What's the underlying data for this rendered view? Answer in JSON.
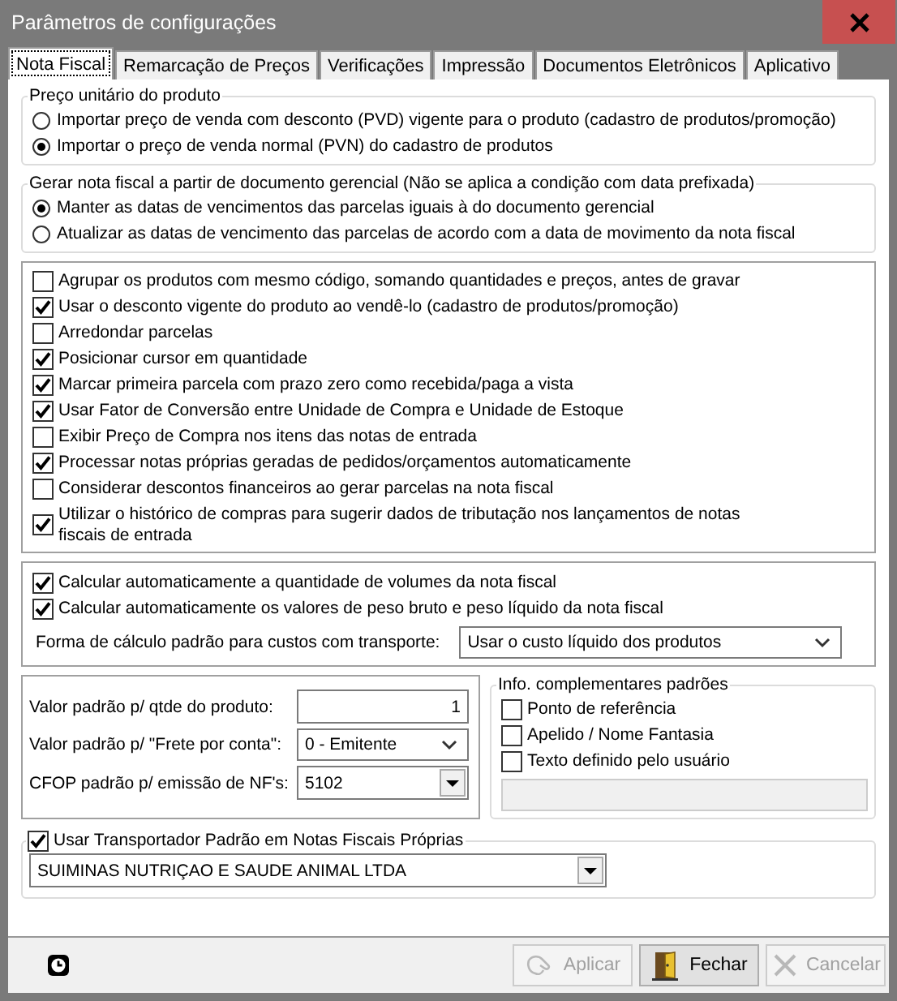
{
  "window": {
    "title": "Parâmetros de configurações"
  },
  "tabs": [
    {
      "label": "Nota Fiscal",
      "selected": true
    },
    {
      "label": "Remarcação de Preços",
      "selected": false
    },
    {
      "label": "Verificações",
      "selected": false
    },
    {
      "label": "Impressão",
      "selected": false
    },
    {
      "label": "Documentos Eletrônicos",
      "selected": false
    },
    {
      "label": "Aplicativo",
      "selected": false
    }
  ],
  "price_group": {
    "title": "Preço unitário do produto",
    "options": [
      {
        "label": "Importar preço de venda com desconto (PVD) vigente para o produto (cadastro de produtos/promoção)",
        "selected": false
      },
      {
        "label": "Importar o preço de venda normal (PVN) do cadastro de produtos",
        "selected": true
      }
    ]
  },
  "document_group": {
    "title": "Gerar nota fiscal a partir de documento gerencial (Não se aplica a condição com data prefixada)",
    "options": [
      {
        "label": "Manter as datas de vencimentos das parcelas iguais à do documento gerencial",
        "selected": true
      },
      {
        "label": "Atualizar as datas de vencimento das parcelas de acordo com a data de movimento da nota fiscal",
        "selected": false
      }
    ]
  },
  "options": [
    {
      "label": "Agrupar os produtos com mesmo código, somando quantidades e preços, antes de gravar",
      "checked": false
    },
    {
      "label": "Usar o desconto vigente do produto ao vendê-lo (cadastro de produtos/promoção)",
      "checked": true
    },
    {
      "label": "Arredondar parcelas",
      "checked": false
    },
    {
      "label": "Posicionar cursor em quantidade",
      "checked": true
    },
    {
      "label": "Marcar primeira parcela com prazo zero como recebida/paga a vista",
      "checked": true
    },
    {
      "label": "Usar Fator de Conversão entre Unidade de Compra e Unidade de Estoque",
      "checked": true
    },
    {
      "label": "Exibir Preço de Compra nos itens das notas de entrada",
      "checked": false
    },
    {
      "label": "Processar notas próprias geradas de pedidos/orçamentos automaticamente",
      "checked": true
    },
    {
      "label": "Considerar descontos financeiros ao gerar parcelas na nota fiscal",
      "checked": false
    },
    {
      "label": "Utilizar o histórico de compras para sugerir dados de tributação nos lançamentos de notas fiscais de entrada",
      "checked": true
    }
  ],
  "transport": {
    "options": [
      {
        "label": "Calcular automaticamente a quantidade de volumes da nota fiscal",
        "checked": true
      },
      {
        "label": "Calcular automaticamente os valores de peso bruto e peso líquido da nota fiscal",
        "checked": true
      }
    ],
    "cost_method": {
      "label": "Forma de cálculo padrão para custos com transporte:",
      "value": "Usar o custo líquido dos produtos"
    }
  },
  "defaults": [
    {
      "kind": "number",
      "label": "Valor padrão p/ qtde do produto:",
      "value": "1"
    },
    {
      "kind": "select",
      "label": "Valor padrão p/ \"Frete por conta\":",
      "value": "0 - Emitente"
    },
    {
      "kind": "combo",
      "label": "CFOP padrão p/ emissão de NF's:",
      "value": "5102"
    }
  ],
  "info_group": {
    "title": "Info. complementares padrões",
    "options": [
      {
        "label": "Ponto de referência",
        "checked": false
      },
      {
        "label": "Apelido / Nome Fantasia",
        "checked": false
      },
      {
        "label": "Texto definido pelo usuário",
        "checked": false
      }
    ],
    "text_field": {
      "disabled": true
    }
  },
  "carrier": {
    "label": "Usar Transportador Padrão em Notas Fiscais Próprias",
    "checked": true,
    "value": "SUIMINAS NUTRIÇAO E SAUDE ANIMAL LTDA"
  },
  "buttons": [
    {
      "kind": "apply",
      "label": "Aplicar",
      "disabled": true
    },
    {
      "kind": "close",
      "label": "Fechar",
      "disabled": false
    },
    {
      "kind": "cancel",
      "label": "Cancelar",
      "disabled": true
    }
  ]
}
